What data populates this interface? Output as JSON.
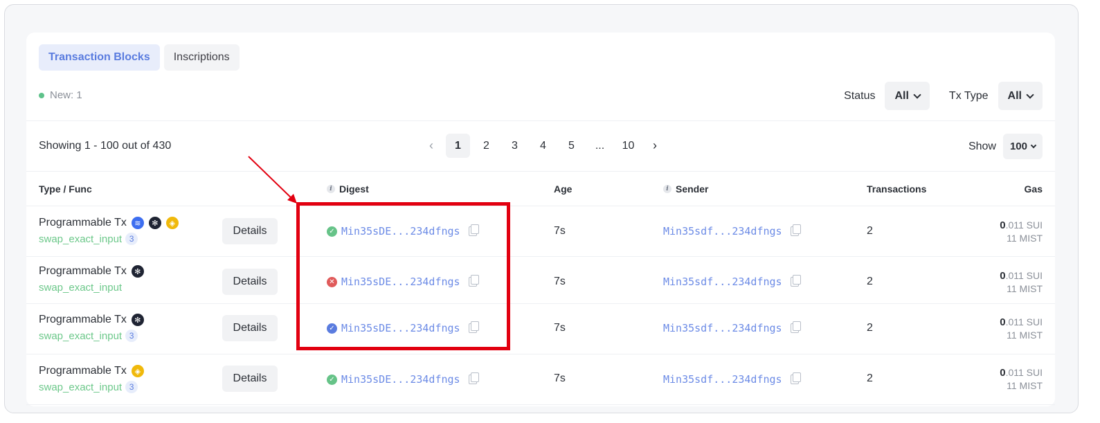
{
  "tabs": [
    {
      "label": "Transaction Blocks",
      "active": true
    },
    {
      "label": "Inscriptions",
      "active": false
    }
  ],
  "new_badge": "New: 1",
  "filters": {
    "status_label": "Status",
    "status_value": "All",
    "txtype_label": "Tx Type",
    "txtype_value": "All"
  },
  "showing_text": "Showing 1 - 100 out of 430",
  "pagination": {
    "prev": "‹",
    "pages": [
      "1",
      "2",
      "3",
      "4",
      "5",
      "...",
      "10"
    ],
    "current": "1",
    "next": "›"
  },
  "page_size": {
    "label": "Show",
    "value": "100"
  },
  "columns": {
    "type_func": "Type / Func",
    "digest": "Digest",
    "age": "Age",
    "sender": "Sender",
    "transactions": "Transactions",
    "gas": "Gas"
  },
  "rows": [
    {
      "type": "Programmable Tx",
      "tokens": [
        "blue",
        "dark",
        "gold"
      ],
      "func": "swap_exact_input",
      "count": "3",
      "details": "Details",
      "status": "success",
      "digest": "Min35sDE...234dfngs",
      "age": "7s",
      "sender": "Min35sdf...234dfngs",
      "transactions": "2",
      "gas_int": "0",
      "gas_frac": ".011 SUI",
      "gas_mist": "11 MIST"
    },
    {
      "type": "Programmable Tx",
      "tokens": [
        "dark"
      ],
      "func": "swap_exact_input",
      "count": "",
      "details": "Details",
      "status": "failed",
      "digest": "Min35sDE...234dfngs",
      "age": "7s",
      "sender": "Min35sdf...234dfngs",
      "transactions": "2",
      "gas_int": "0",
      "gas_frac": ".011 SUI",
      "gas_mist": "11 MIST"
    },
    {
      "type": "Programmable Tx",
      "tokens": [
        "dark"
      ],
      "func": "swap_exact_input",
      "count": "3",
      "details": "Details",
      "status": "pending",
      "digest": "Min35sDE...234dfngs",
      "age": "7s",
      "sender": "Min35sdf...234dfngs",
      "transactions": "2",
      "gas_int": "0",
      "gas_frac": ".011 SUI",
      "gas_mist": "11 MIST"
    },
    {
      "type": "Programmable Tx",
      "tokens": [
        "gold"
      ],
      "func": "swap_exact_input",
      "count": "3",
      "details": "Details",
      "status": "success",
      "digest": "Min35sDE...234dfngs",
      "age": "7s",
      "sender": "Min35sdf...234dfngs",
      "transactions": "2",
      "gas_int": "0",
      "gas_frac": ".011 SUI",
      "gas_mist": "11 MIST"
    }
  ],
  "colors": {
    "accent": "#5a7cdf",
    "success": "#66c388",
    "failed": "#e05a5a",
    "highlight": "#e20010",
    "func": "#6cc88a"
  }
}
